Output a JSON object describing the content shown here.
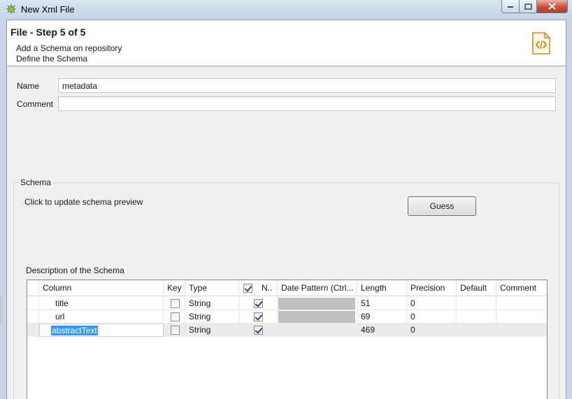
{
  "window": {
    "title": "New Xml File"
  },
  "header": {
    "step_title": "File - Step 5 of 5",
    "line1": "Add a Schema on repository",
    "line2": "Define the Schema"
  },
  "form": {
    "name_label": "Name",
    "name_value": "metadata",
    "comment_label": "Comment",
    "comment_value": ""
  },
  "schema_group": {
    "title": "Schema",
    "hint": "Click to update schema preview",
    "guess_label": "Guess",
    "description": "Description of the Schema"
  },
  "table": {
    "columns": [
      "Column",
      "Key",
      "Type",
      "N..",
      "Date Pattern (Ctrl...",
      "Length",
      "Precision",
      "Default",
      "Comment"
    ],
    "rows": [
      {
        "column": "title",
        "key": false,
        "type": "String",
        "nullable": true,
        "length": "51",
        "precision": "0",
        "default": "",
        "comment": ""
      },
      {
        "column": "url",
        "key": false,
        "type": "String",
        "nullable": true,
        "length": "69",
        "precision": "0",
        "default": "",
        "comment": ""
      },
      {
        "column": "abstractText",
        "key": false,
        "type": "String",
        "nullable": true,
        "length": "469",
        "precision": "0",
        "default": "",
        "comment": ""
      }
    ]
  }
}
